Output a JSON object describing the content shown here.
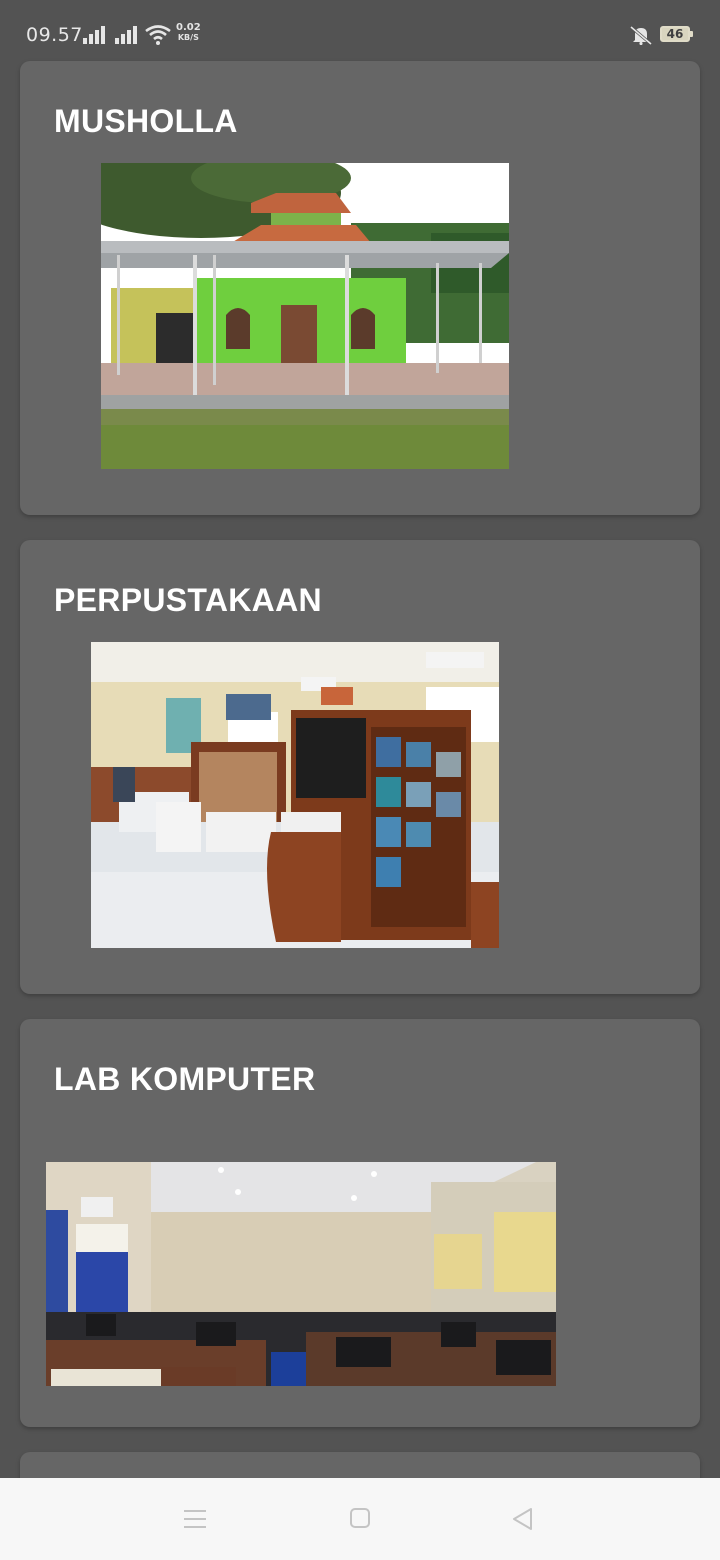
{
  "status_bar": {
    "time": "09.57",
    "net_speed_value": "0.02",
    "net_speed_unit": "KB/S",
    "battery_level": "46",
    "icons": [
      "signal-icon",
      "signal-icon",
      "wifi-icon",
      "mute-bell-icon",
      "battery-icon"
    ]
  },
  "facilities": [
    {
      "title": "MUSHOLLA",
      "image_subject": "mosque-with-green-walls"
    },
    {
      "title": "PERPUSTAKAAN",
      "image_subject": "library-interior"
    },
    {
      "title": "LAB KOMPUTER",
      "image_subject": "computer-lab-interior"
    }
  ],
  "nav_bar": {
    "icons": [
      "menu-icon",
      "home-icon",
      "back-icon"
    ]
  },
  "colors": {
    "background": "#535353",
    "card": "#666666",
    "title_text": "#ffffff",
    "nav_bar": "#f7f7f7"
  }
}
